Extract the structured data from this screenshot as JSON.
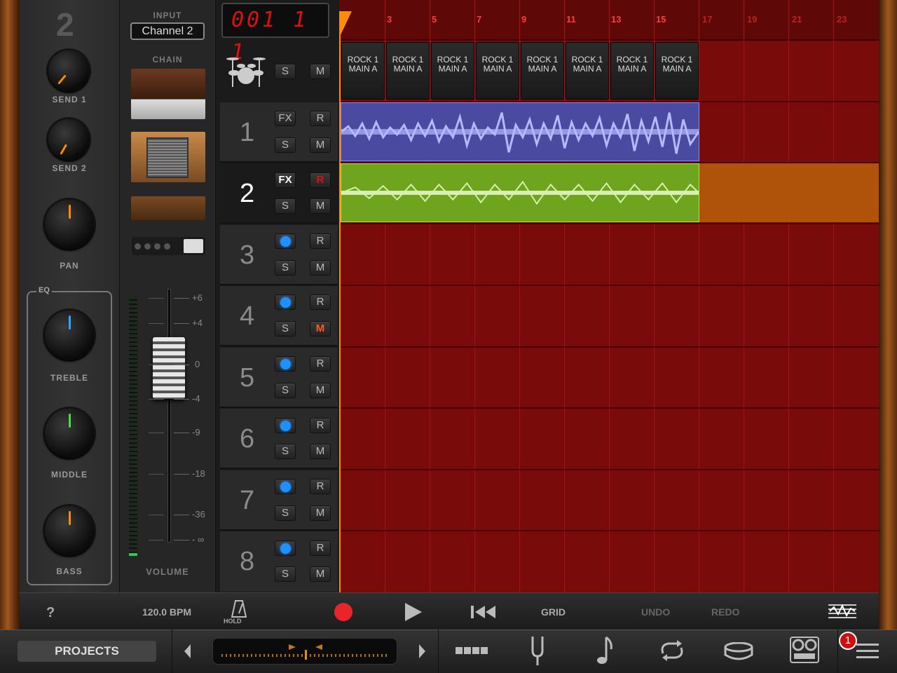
{
  "channel": {
    "number": "2",
    "knobs": {
      "send1": "SEND 1",
      "send2": "SEND 2",
      "pan": "PAN",
      "treble": "TREBLE",
      "middle": "MIDDLE",
      "bass": "BASS"
    },
    "eq_label": "EQ",
    "input_label": "INPUT",
    "input_value": "Channel 2",
    "chain_label": "CHAIN",
    "volume_label": "VOLUME",
    "scale": [
      "+6",
      "+4",
      "0",
      "-4",
      "-9",
      "-18",
      "-36",
      "- ∞"
    ]
  },
  "lcd": "001 1 1",
  "tracks": [
    {
      "number": "1",
      "fx": "FX",
      "r": "R",
      "s": "S",
      "m": "M"
    },
    {
      "number": "2",
      "fx": "FX",
      "r": "R",
      "s": "S",
      "m": "M"
    },
    {
      "number": "3",
      "r": "R",
      "s": "S",
      "m": "M"
    },
    {
      "number": "4",
      "r": "R",
      "s": "S",
      "m": "M"
    },
    {
      "number": "5",
      "r": "R",
      "s": "S",
      "m": "M"
    },
    {
      "number": "6",
      "r": "R",
      "s": "S",
      "m": "M"
    },
    {
      "number": "7",
      "r": "R",
      "s": "S",
      "m": "M"
    },
    {
      "number": "8",
      "r": "R",
      "s": "S",
      "m": "M"
    }
  ],
  "drum_track": {
    "s": "S",
    "m": "M"
  },
  "ruler": [
    "3",
    "5",
    "7",
    "9",
    "11",
    "13",
    "15",
    "17",
    "19",
    "21",
    "23"
  ],
  "patterns": [
    "ROCK 1 MAIN A",
    "ROCK 1 MAIN A",
    "ROCK 1 MAIN A",
    "ROCK 1 MAIN A",
    "ROCK 1 MAIN A",
    "ROCK 1 MAIN A",
    "ROCK 1 MAIN A",
    "ROCK 1 MAIN A"
  ],
  "transport": {
    "help": "?",
    "bpm": "120.0 BPM",
    "hold": "HOLD",
    "grid": "GRID",
    "undo": "UNDO",
    "redo": "REDO"
  },
  "bottom": {
    "projects": "PROJECTS",
    "badge": "1"
  },
  "colors": {
    "record": "#e8262a",
    "lcd": "#e01010",
    "grid_bg": "#7a0b0b",
    "track1_region": "#4a4aa0",
    "track2_region": "#6ea41e"
  }
}
